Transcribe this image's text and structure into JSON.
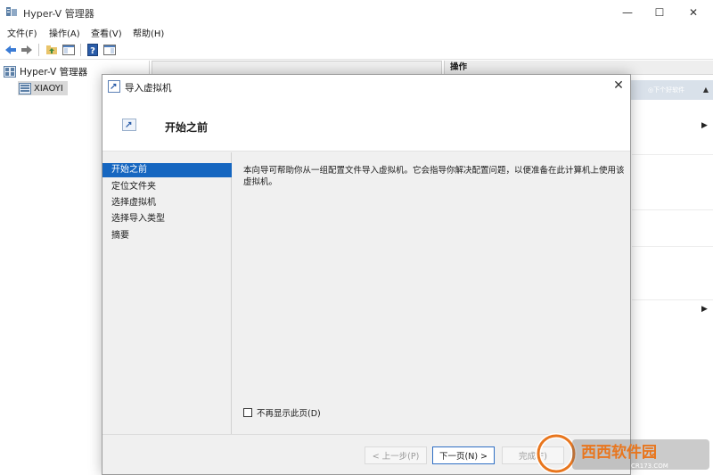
{
  "window": {
    "title": "Hyper-V 管理器",
    "controls": {
      "minimize": "—",
      "maximize": "☐",
      "close": "✕"
    }
  },
  "menu": [
    {
      "label": "文件(F)"
    },
    {
      "label": "操作(A)"
    },
    {
      "label": "查看(V)"
    },
    {
      "label": "帮助(H)"
    }
  ],
  "tree": {
    "root": "Hyper-V 管理器",
    "child": "XIAOYI"
  },
  "actions_panel": {
    "header": "操作",
    "subheader": "◎下个好软件"
  },
  "dialog": {
    "title": "导入虚拟机",
    "close": "✕",
    "header_title": "开始之前",
    "steps": [
      {
        "label": "开始之前",
        "active": true
      },
      {
        "label": "定位文件夹",
        "active": false
      },
      {
        "label": "选择虚拟机",
        "active": false
      },
      {
        "label": "选择导入类型",
        "active": false
      },
      {
        "label": "摘要",
        "active": false
      }
    ],
    "description": "本向导可帮助你从一组配置文件导入虚拟机。它会指导你解决配置问题，以便准备在此计算机上使用该虚拟机。",
    "dont_show_label": "不再显示此页(D)",
    "buttons": {
      "prev": "< 上一步(P)",
      "next": "下一页(N) >",
      "finish": "完成(F)"
    }
  },
  "watermark": {
    "brand": "西西软件园",
    "url": "CR173.COM"
  },
  "colors": {
    "accent": "#1566c0",
    "dialog_bg": "#f0f0f0",
    "watermark_orange": "#e8761e"
  }
}
